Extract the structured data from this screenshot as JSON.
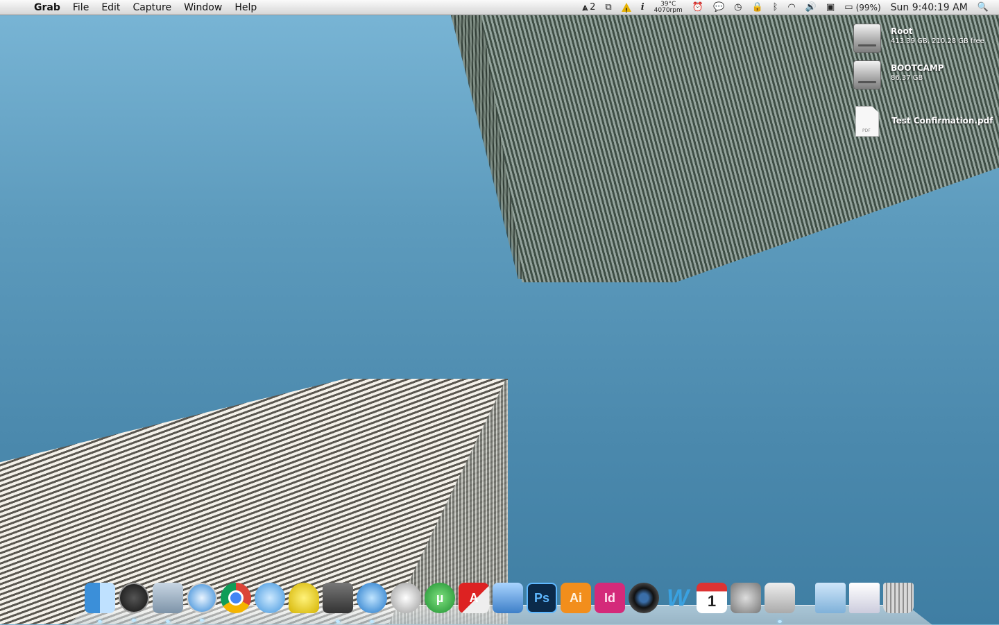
{
  "menubar": {
    "app_name": "Grab",
    "menus": [
      "File",
      "Edit",
      "Capture",
      "Window",
      "Help"
    ],
    "status": {
      "adobe_count": "2",
      "temperature": "39°C",
      "fan_speed": "4070rpm",
      "battery_percent": "(99%)",
      "clock": "Sun 9:40:19 AM"
    }
  },
  "desktop": {
    "icons": [
      {
        "name": "Root",
        "detail": "413.39 GB, 210.28 GB free"
      },
      {
        "name": "BOOTCAMP",
        "detail": "86.37 GB"
      },
      {
        "name": "Test Confirmation.pdf",
        "file_badge": "PDF"
      }
    ]
  },
  "dock": {
    "items": [
      {
        "label": "Finder",
        "text": ""
      },
      {
        "label": "Dashboard",
        "text": ""
      },
      {
        "label": "Mail",
        "text": ""
      },
      {
        "label": "Safari",
        "text": ""
      },
      {
        "label": "Chrome",
        "text": ""
      },
      {
        "label": "iChat",
        "text": ""
      },
      {
        "label": "Adium",
        "text": ""
      },
      {
        "label": "Steam",
        "text": ""
      },
      {
        "label": "iTunes",
        "text": ""
      },
      {
        "label": "Ventrilo",
        "text": ""
      },
      {
        "label": "uTorrent",
        "text": "µ"
      },
      {
        "label": "AutoCAD",
        "text": "A"
      },
      {
        "label": "Xcode",
        "text": ""
      },
      {
        "label": "Photoshop",
        "text": "Ps"
      },
      {
        "label": "Illustrator",
        "text": "Ai"
      },
      {
        "label": "InDesign",
        "text": "Id"
      },
      {
        "label": "Aperture",
        "text": ""
      },
      {
        "label": "Word",
        "text": "W"
      },
      {
        "label": "iCal",
        "text": "1"
      },
      {
        "label": "System Preferences",
        "text": ""
      },
      {
        "label": "Grab",
        "text": ""
      },
      {
        "label": "Documents",
        "text": ""
      },
      {
        "label": "Downloads",
        "text": ""
      },
      {
        "label": "Trash",
        "text": ""
      }
    ]
  }
}
